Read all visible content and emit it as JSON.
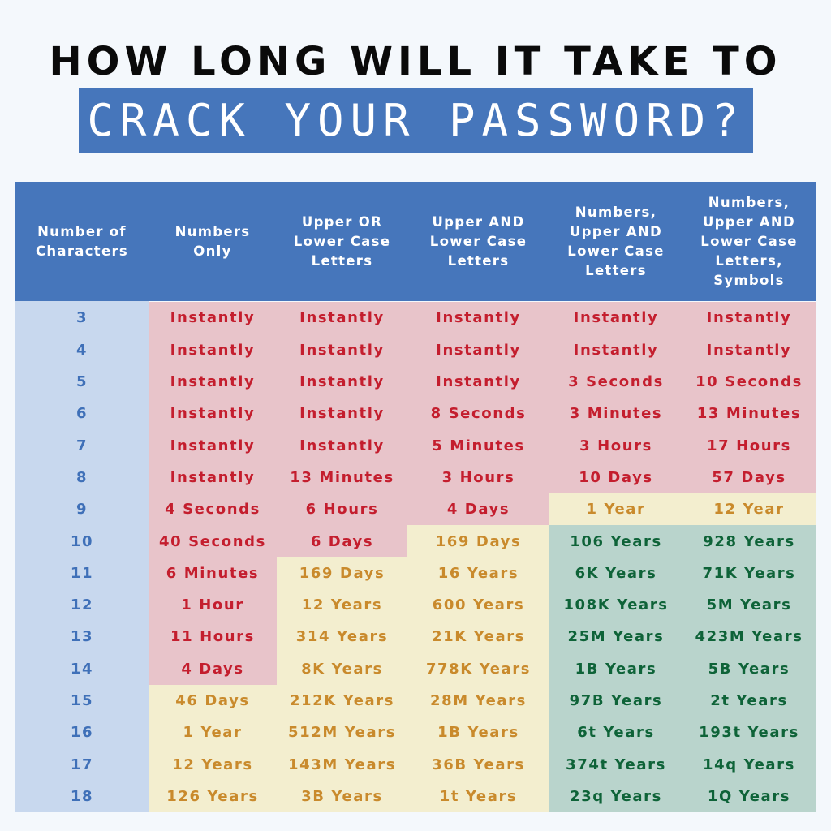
{
  "title": {
    "line1": "HOW LONG WILL IT TAKE TO",
    "line2": "CRACK YOUR PASSWORD?"
  },
  "colors": {
    "header_bg": "#4676bb",
    "index_bg": "#c8d8ee",
    "danger_bg": "#e8c4ca",
    "danger_text": "#c41e2e",
    "moderate_bg": "#f3eecf",
    "moderate_text": "#c98a2c",
    "safe_bg": "#b9d4cc",
    "safe_text": "#0e6338"
  },
  "chart_data": {
    "type": "table",
    "title": "HOW LONG WILL IT TAKE TO CRACK YOUR PASSWORD?",
    "columns": [
      {
        "lines": [
          "Number of",
          "Characters"
        ]
      },
      {
        "lines": [
          "Numbers",
          "Only"
        ]
      },
      {
        "lines": [
          "Upper OR",
          "Lower Case",
          "Letters"
        ]
      },
      {
        "lines": [
          "Upper AND",
          "Lower Case",
          "Letters"
        ]
      },
      {
        "lines": [
          "Numbers,",
          "Upper AND",
          "Lower Case",
          "Letters"
        ]
      },
      {
        "lines": [
          "Numbers,",
          "Upper AND",
          "Lower Case",
          "Letters,",
          "Symbols"
        ]
      }
    ],
    "rows": [
      {
        "chars": "3",
        "cells": [
          {
            "v": "Instantly",
            "level": "red"
          },
          {
            "v": "Instantly",
            "level": "red"
          },
          {
            "v": "Instantly",
            "level": "red"
          },
          {
            "v": "Instantly",
            "level": "red"
          },
          {
            "v": "Instantly",
            "level": "red"
          }
        ]
      },
      {
        "chars": "4",
        "cells": [
          {
            "v": "Instantly",
            "level": "red"
          },
          {
            "v": "Instantly",
            "level": "red"
          },
          {
            "v": "Instantly",
            "level": "red"
          },
          {
            "v": "Instantly",
            "level": "red"
          },
          {
            "v": "Instantly",
            "level": "red"
          }
        ]
      },
      {
        "chars": "5",
        "cells": [
          {
            "v": "Instantly",
            "level": "red"
          },
          {
            "v": "Instantly",
            "level": "red"
          },
          {
            "v": "Instantly",
            "level": "red"
          },
          {
            "v": "3 Seconds",
            "level": "red"
          },
          {
            "v": "10 Seconds",
            "level": "red"
          }
        ]
      },
      {
        "chars": "6",
        "cells": [
          {
            "v": "Instantly",
            "level": "red"
          },
          {
            "v": "Instantly",
            "level": "red"
          },
          {
            "v": "8 Seconds",
            "level": "red"
          },
          {
            "v": "3 Minutes",
            "level": "red"
          },
          {
            "v": "13 Minutes",
            "level": "red"
          }
        ]
      },
      {
        "chars": "7",
        "cells": [
          {
            "v": "Instantly",
            "level": "red"
          },
          {
            "v": "Instantly",
            "level": "red"
          },
          {
            "v": "5 Minutes",
            "level": "red"
          },
          {
            "v": "3 Hours",
            "level": "red"
          },
          {
            "v": "17 Hours",
            "level": "red"
          }
        ]
      },
      {
        "chars": "8",
        "cells": [
          {
            "v": "Instantly",
            "level": "red"
          },
          {
            "v": "13 Minutes",
            "level": "red"
          },
          {
            "v": "3 Hours",
            "level": "red"
          },
          {
            "v": "10 Days",
            "level": "red"
          },
          {
            "v": "57 Days",
            "level": "red"
          }
        ]
      },
      {
        "chars": "9",
        "cells": [
          {
            "v": "4 Seconds",
            "level": "red"
          },
          {
            "v": "6 Hours",
            "level": "red"
          },
          {
            "v": "4 Days",
            "level": "red"
          },
          {
            "v": "1 Year",
            "level": "yellow"
          },
          {
            "v": "12 Year",
            "level": "yellow"
          }
        ]
      },
      {
        "chars": "10",
        "cells": [
          {
            "v": "40 Seconds",
            "level": "red"
          },
          {
            "v": "6 Days",
            "level": "red"
          },
          {
            "v": "169 Days",
            "level": "yellow"
          },
          {
            "v": "106 Years",
            "level": "green"
          },
          {
            "v": "928 Years",
            "level": "green"
          }
        ]
      },
      {
        "chars": "11",
        "cells": [
          {
            "v": "6 Minutes",
            "level": "red"
          },
          {
            "v": "169 Days",
            "level": "yellow"
          },
          {
            "v": "16 Years",
            "level": "yellow"
          },
          {
            "v": "6K Years",
            "level": "green"
          },
          {
            "v": "71K Years",
            "level": "green"
          }
        ]
      },
      {
        "chars": "12",
        "cells": [
          {
            "v": "1 Hour",
            "level": "red"
          },
          {
            "v": "12 Years",
            "level": "yellow"
          },
          {
            "v": "600 Years",
            "level": "yellow"
          },
          {
            "v": "108K Years",
            "level": "green"
          },
          {
            "v": "5M Years",
            "level": "green"
          }
        ]
      },
      {
        "chars": "13",
        "cells": [
          {
            "v": "11 Hours",
            "level": "red"
          },
          {
            "v": "314 Years",
            "level": "yellow"
          },
          {
            "v": "21K Years",
            "level": "yellow"
          },
          {
            "v": "25M Years",
            "level": "green"
          },
          {
            "v": "423M Years",
            "level": "green"
          }
        ]
      },
      {
        "chars": "14",
        "cells": [
          {
            "v": "4 Days",
            "level": "red"
          },
          {
            "v": "8K Years",
            "level": "yellow"
          },
          {
            "v": "778K Years",
            "level": "yellow"
          },
          {
            "v": "1B Years",
            "level": "green"
          },
          {
            "v": "5B Years",
            "level": "green"
          }
        ]
      },
      {
        "chars": "15",
        "cells": [
          {
            "v": "46 Days",
            "level": "yellow"
          },
          {
            "v": "212K Years",
            "level": "yellow"
          },
          {
            "v": "28M Years",
            "level": "yellow"
          },
          {
            "v": "97B Years",
            "level": "green"
          },
          {
            "v": "2t Years",
            "level": "green"
          }
        ]
      },
      {
        "chars": "16",
        "cells": [
          {
            "v": "1 Year",
            "level": "yellow"
          },
          {
            "v": "512M Years",
            "level": "yellow"
          },
          {
            "v": "1B Years",
            "level": "yellow"
          },
          {
            "v": "6t Years",
            "level": "green"
          },
          {
            "v": "193t Years",
            "level": "green"
          }
        ]
      },
      {
        "chars": "17",
        "cells": [
          {
            "v": "12 Years",
            "level": "yellow"
          },
          {
            "v": "143M Years",
            "level": "yellow"
          },
          {
            "v": "36B Years",
            "level": "yellow"
          },
          {
            "v": "374t Years",
            "level": "green"
          },
          {
            "v": "14q Years",
            "level": "green"
          }
        ]
      },
      {
        "chars": "18",
        "cells": [
          {
            "v": "126 Years",
            "level": "yellow"
          },
          {
            "v": "3B Years",
            "level": "yellow"
          },
          {
            "v": "1t Years",
            "level": "yellow"
          },
          {
            "v": "23q Years",
            "level": "green"
          },
          {
            "v": "1Q Years",
            "level": "green"
          }
        ]
      }
    ]
  }
}
